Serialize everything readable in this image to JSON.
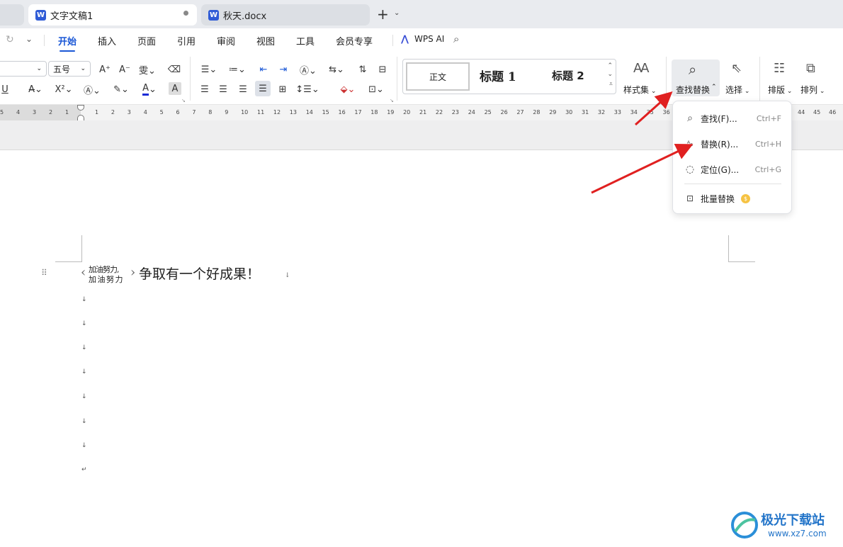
{
  "tabs": [
    {
      "label": "文字文稿1",
      "active": true
    },
    {
      "label": "秋天.docx",
      "active": false
    }
  ],
  "tab_add": "+",
  "menu": {
    "items": [
      "开始",
      "插入",
      "页面",
      "引用",
      "审阅",
      "视图",
      "工具",
      "会员专享"
    ],
    "wps_ai": "WPS AI"
  },
  "ribbon": {
    "font_name": "",
    "font_size": "五号",
    "styles": [
      "正文",
      "标题 1",
      "标题 2"
    ],
    "style_set": "样式集",
    "find_replace": "查找替换",
    "select": "选择",
    "layout": "排版",
    "arrange": "排列"
  },
  "ruler": {
    "left": [
      "5",
      "4",
      "3",
      "2",
      "1"
    ],
    "right": [
      "1",
      "2",
      "3",
      "4",
      "5",
      "6",
      "7",
      "8",
      "9",
      "10",
      "11",
      "12",
      "13",
      "14",
      "15",
      "16",
      "17",
      "18",
      "19",
      "20",
      "21",
      "22",
      "23",
      "24",
      "25",
      "26",
      "27",
      "28",
      "29",
      "30",
      "31",
      "32",
      "33",
      "34",
      "35",
      "36"
    ],
    "far": [
      "44",
      "45",
      "46"
    ]
  },
  "dropdown": {
    "items": [
      {
        "label": "查找(F)...",
        "shortcut": "Ctrl+F",
        "icon": "search-icon"
      },
      {
        "label": "替换(R)...",
        "shortcut": "Ctrl+H",
        "icon": "replace-icon"
      },
      {
        "label": "定位(G)...",
        "shortcut": "Ctrl+G",
        "icon": "locate-icon"
      }
    ],
    "batch": "批量替换"
  },
  "document": {
    "ruby_top": "加油努力,",
    "ruby_bottom": "加 油 努 力",
    "main_text": "争取有一个好成果！"
  },
  "watermark": {
    "name": "极光下载站",
    "url": "www.xz7.com"
  },
  "colors": {
    "accent": "#1a57d6",
    "arrow": "#e02020",
    "font_color": "#1a2bd6"
  }
}
